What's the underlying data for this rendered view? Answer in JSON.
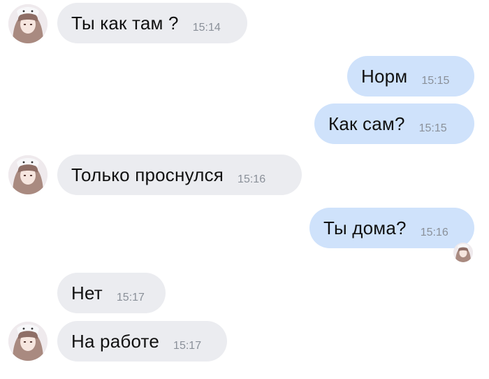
{
  "messages": [
    {
      "text": "Ты как там ?",
      "time": "15:14",
      "direction": "incoming",
      "avatar": "girl-avatar-icon"
    },
    {
      "text": "Норм",
      "time": "15:15",
      "direction": "outgoing"
    },
    {
      "text": "Как сам?",
      "time": "15:15",
      "direction": "outgoing"
    },
    {
      "text": "Только проснулся",
      "time": "15:16",
      "direction": "incoming",
      "avatar": "girl-avatar-icon"
    },
    {
      "text": "Ты дома?",
      "time": "15:16",
      "direction": "outgoing",
      "read_receipt_avatar": "girl-avatar-icon"
    },
    {
      "text": "Нет",
      "time": "15:17",
      "direction": "incoming"
    },
    {
      "text": "На работе",
      "time": "15:17",
      "direction": "incoming",
      "avatar": "girl-avatar-icon"
    }
  ],
  "colors": {
    "incoming_bubble": "#ebecf0",
    "outgoing_bubble": "#cfe2fb",
    "text": "#111111",
    "time": "#8a9099"
  }
}
